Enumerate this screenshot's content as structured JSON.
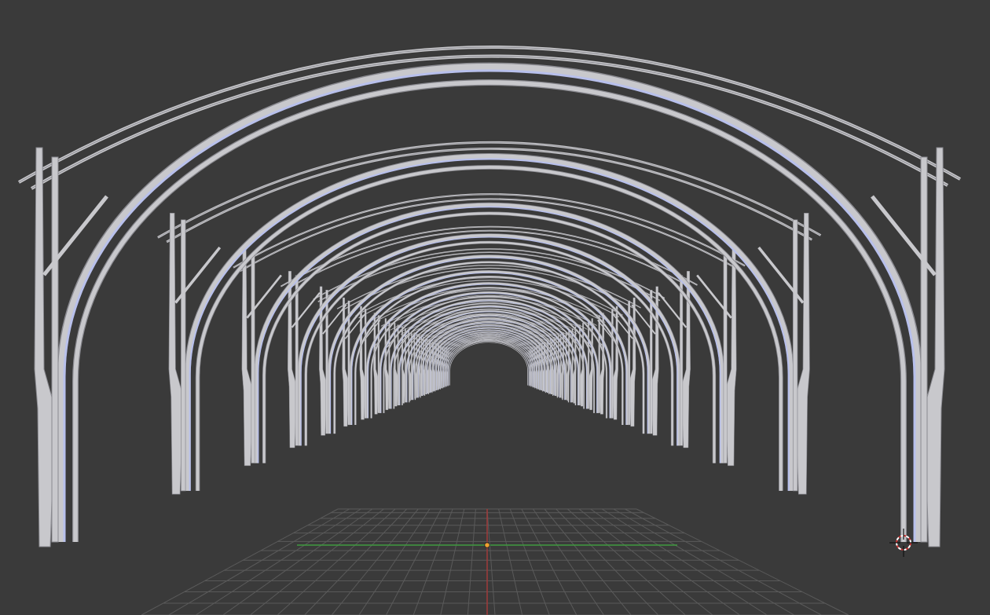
{
  "viewport": {
    "background_color": "#3a3a3a",
    "grid_color": "#5a5a5a",
    "axis_x_color": "#3f9a3f",
    "axis_y_color": "#a03a3a",
    "origin_color": "#f0a030",
    "frame_color": "#c8c8cc",
    "frame_highlight_color": "#b8c0ec",
    "frame_shadow_color": "#8a8a90",
    "cursor_outer_color": "#c83232",
    "cursor_inner_color": "#ffffff"
  },
  "scene": {
    "object": "arched-greenhouse-frame",
    "arch_count_visible": 24,
    "icons": [
      "3d-cursor-icon",
      "origin-point-icon"
    ]
  }
}
